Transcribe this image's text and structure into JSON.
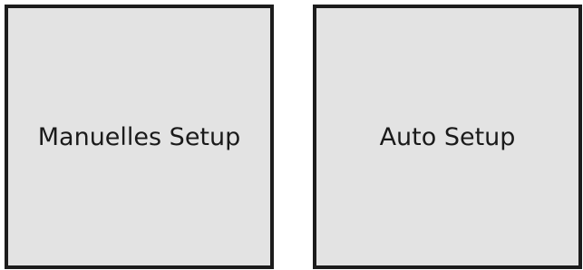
{
  "setup_options": {
    "manual_label": "Manuelles Setup",
    "auto_label": "Auto Setup"
  }
}
